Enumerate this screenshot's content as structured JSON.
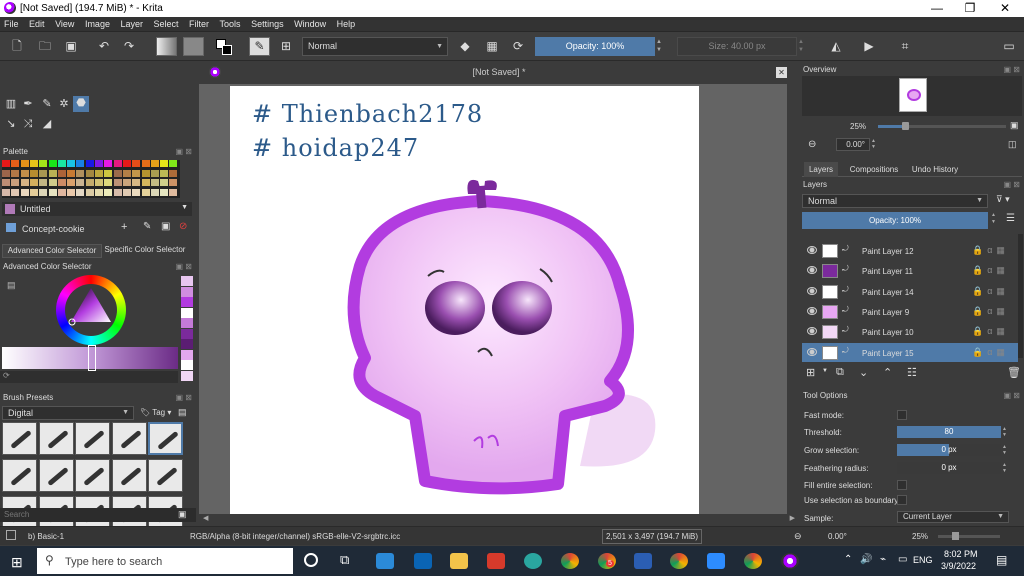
{
  "window": {
    "title": "[Not Saved]  (194.7 MiB)  * - Krita",
    "minimize": "—",
    "restore": "❐",
    "close": "✕"
  },
  "menu": [
    "File",
    "Edit",
    "View",
    "Image",
    "Layer",
    "Select",
    "Filter",
    "Tools",
    "Settings",
    "Window",
    "Help"
  ],
  "toolbar": {
    "blend_mode": "Normal",
    "opacity": "Opacity: 100%",
    "size": "Size: 40.00 px"
  },
  "left_dock": {
    "palette_title": "Palette",
    "palette_name": "Untitled",
    "palette_entry": "Concept-cookie",
    "tabs": [
      "Advanced Color Selector",
      "Specific Color Selector"
    ],
    "color_selector_title": "Advanced Color Selector",
    "brush_presets_title": "Brush Presets",
    "brush_tag_filter": "Digital",
    "brush_tag_button": "Tag",
    "search_placeholder": "Search"
  },
  "canvas": {
    "tab_title": "[Not Saved]  *",
    "text_line1": "# Thienbach2178",
    "text_line2": "# hoidap247",
    "drawing": "Purple cartoon character"
  },
  "right_dock": {
    "overview_title": "Overview",
    "overview_zoom": "25%",
    "rotation": "0.00°",
    "tabs": [
      "Layers",
      "Compositions",
      "Undo History"
    ],
    "layers_title": "Layers",
    "layers_blend": "Normal",
    "layers_opacity": "Opacity:  100%",
    "layers": [
      "Paint Layer 12",
      "Paint Layer 11",
      "Paint Layer 14",
      "Paint Layer 9",
      "Paint Layer 10",
      "Paint Layer 15"
    ],
    "selected_layer": "Paint Layer 15",
    "tool_options_title": "Tool Options",
    "options": {
      "fast_mode": "Fast mode:",
      "threshold_label": "Threshold:",
      "threshold_value": "80",
      "grow_label": "Grow selection:",
      "grow_value": "0 px",
      "feather_label": "Feathering radius:",
      "feather_value": "0 px",
      "fill_entire": "Fill entire selection:",
      "use_boundary": "Use selection as boundary:",
      "sample_label": "Sample:",
      "sample_value": "Current Layer"
    }
  },
  "status": {
    "brush": "b) Basic-1",
    "color_info": "RGB/Alpha (8-bit integer/channel)  sRGB-elle-V2-srgbtrc.icc",
    "dimensions": "2,501 x 3,497 (194.7 MiB)",
    "rotation": "0.00°",
    "zoom": "25%"
  },
  "taskbar": {
    "search_placeholder": "Type here to search",
    "time": "8:02 PM",
    "date": "3/9/2022",
    "lang": "ENG",
    "notification_count": "5"
  },
  "colors": {
    "accent": "#4f7aa8",
    "purple": "#b23ce0"
  }
}
